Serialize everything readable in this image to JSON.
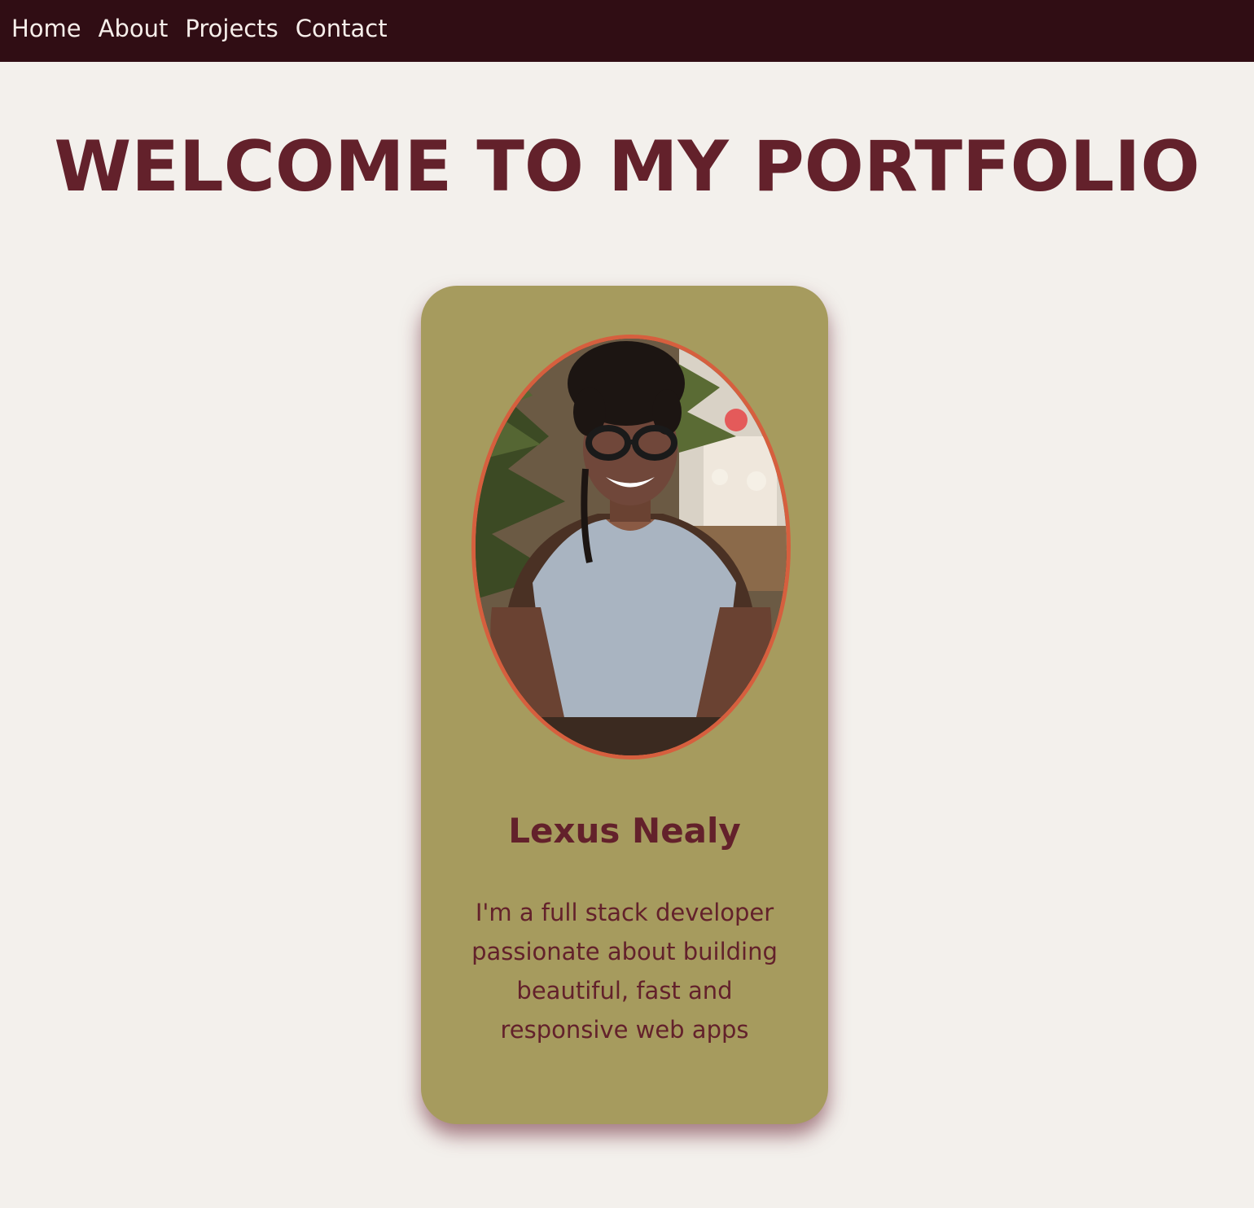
{
  "nav": {
    "items": [
      {
        "label": "Home"
      },
      {
        "label": "About"
      },
      {
        "label": "Projects"
      },
      {
        "label": "Contact"
      }
    ]
  },
  "hero": {
    "title": "WELCOME TO MY PORTFOLIO"
  },
  "profile": {
    "name": "Lexus Nealy",
    "bio": "I'm a full stack developer passionate about building beautiful, fast and responsive web apps"
  },
  "colors": {
    "nav_bg": "#300d14",
    "page_bg": "#f3f0ec",
    "accent": "#63212b",
    "card_bg": "#a69b5e",
    "avatar_border": "#d65f3e"
  }
}
